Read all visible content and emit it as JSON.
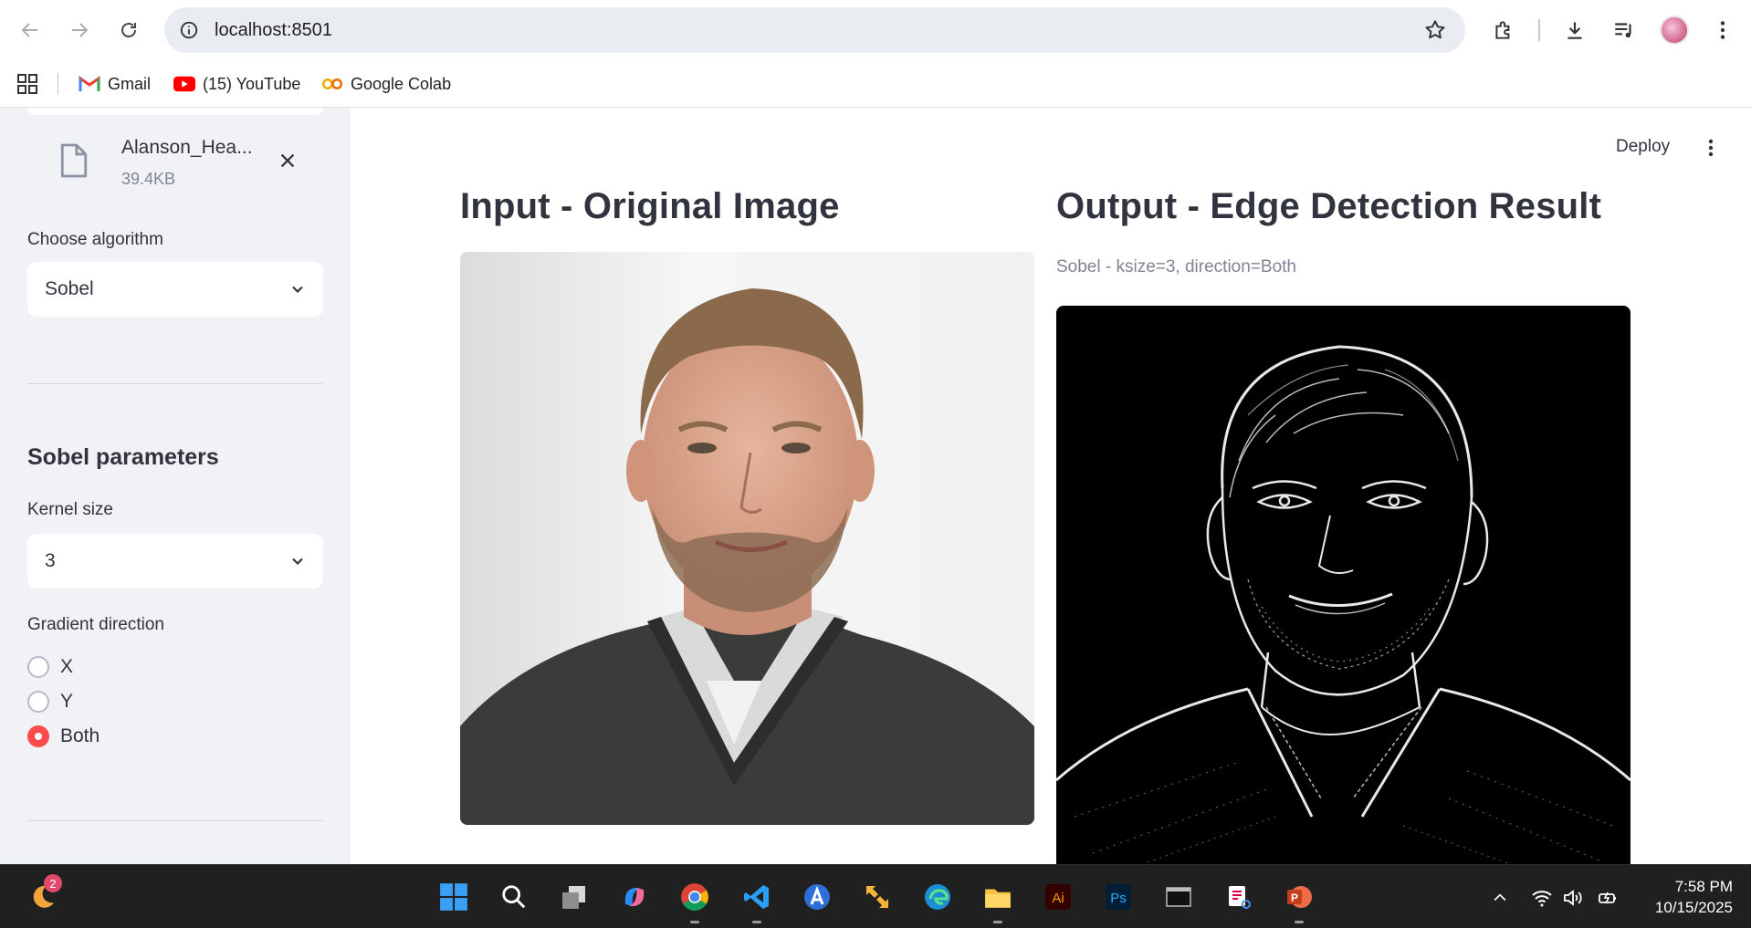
{
  "browser": {
    "url": "localhost:8501",
    "bookmarks": [
      {
        "label": "Gmail",
        "icon": "gmail-icon"
      },
      {
        "label": "(15) YouTube",
        "icon": "youtube-icon"
      },
      {
        "label": "Google Colab",
        "icon": "colab-icon"
      }
    ]
  },
  "sidebar": {
    "file": {
      "name": "Alanson_Hea...",
      "size": "39.4KB"
    },
    "algorithm_label": "Choose algorithm",
    "algorithm_value": "Sobel",
    "params_heading": "Sobel parameters",
    "kernel_label": "Kernel size",
    "kernel_value": "3",
    "direction_label": "Gradient direction",
    "direction_options": [
      {
        "label": "X",
        "selected": false
      },
      {
        "label": "Y",
        "selected": false
      },
      {
        "label": "Both",
        "selected": true
      }
    ]
  },
  "main": {
    "deploy_label": "Deploy",
    "input_title": "Input - Original Image",
    "output_title": "Output - Edge Detection Result",
    "output_caption": "Sobel - ksize=3, direction=Both"
  },
  "taskbar": {
    "notification_count": "2",
    "time": "7:58 PM",
    "date": "10/15/2025"
  },
  "colors": {
    "accent": "#ff4b4b",
    "sidebar_bg": "#f0f2f6",
    "text": "#31333f",
    "muted": "#808495"
  }
}
